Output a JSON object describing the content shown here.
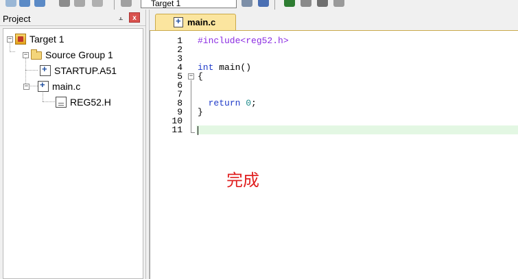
{
  "toolbar": {
    "target_combo": "Target 1"
  },
  "project_panel": {
    "title": "Project",
    "pin_glyph": "⫠",
    "close_glyph": "x",
    "tree": [
      {
        "label": "Target 1",
        "icon": "target-icon",
        "expander": "−"
      },
      {
        "label": "Source Group 1",
        "icon": "folder-icon",
        "expander": "−"
      },
      {
        "label": "STARTUP.A51",
        "icon": "source-file-icon"
      },
      {
        "label": "main.c",
        "icon": "source-file-icon",
        "expander": "−"
      },
      {
        "label": "REG52.H",
        "icon": "header-file-icon"
      }
    ]
  },
  "editor": {
    "active_tab": "main.c",
    "line_numbers": [
      "1",
      "2",
      "3",
      "4",
      "5",
      "6",
      "7",
      "8",
      "9",
      "10",
      "11"
    ],
    "code": {
      "l1_pp": "#include<reg52.h>",
      "l4_kw": "int",
      "l4_rest": " main()",
      "l5": "{",
      "l8_kw": "return",
      "l8_num": "0",
      "l8_semi": ";",
      "l9": "}"
    },
    "annotation": "完成"
  },
  "colors": {
    "keyword": "#1f3bc9",
    "preprocessor": "#8a2be2",
    "number": "#1c8a8a",
    "tab_active": "#fbe59f",
    "current_line": "#e3f7e3",
    "annotation": "#e02020"
  }
}
